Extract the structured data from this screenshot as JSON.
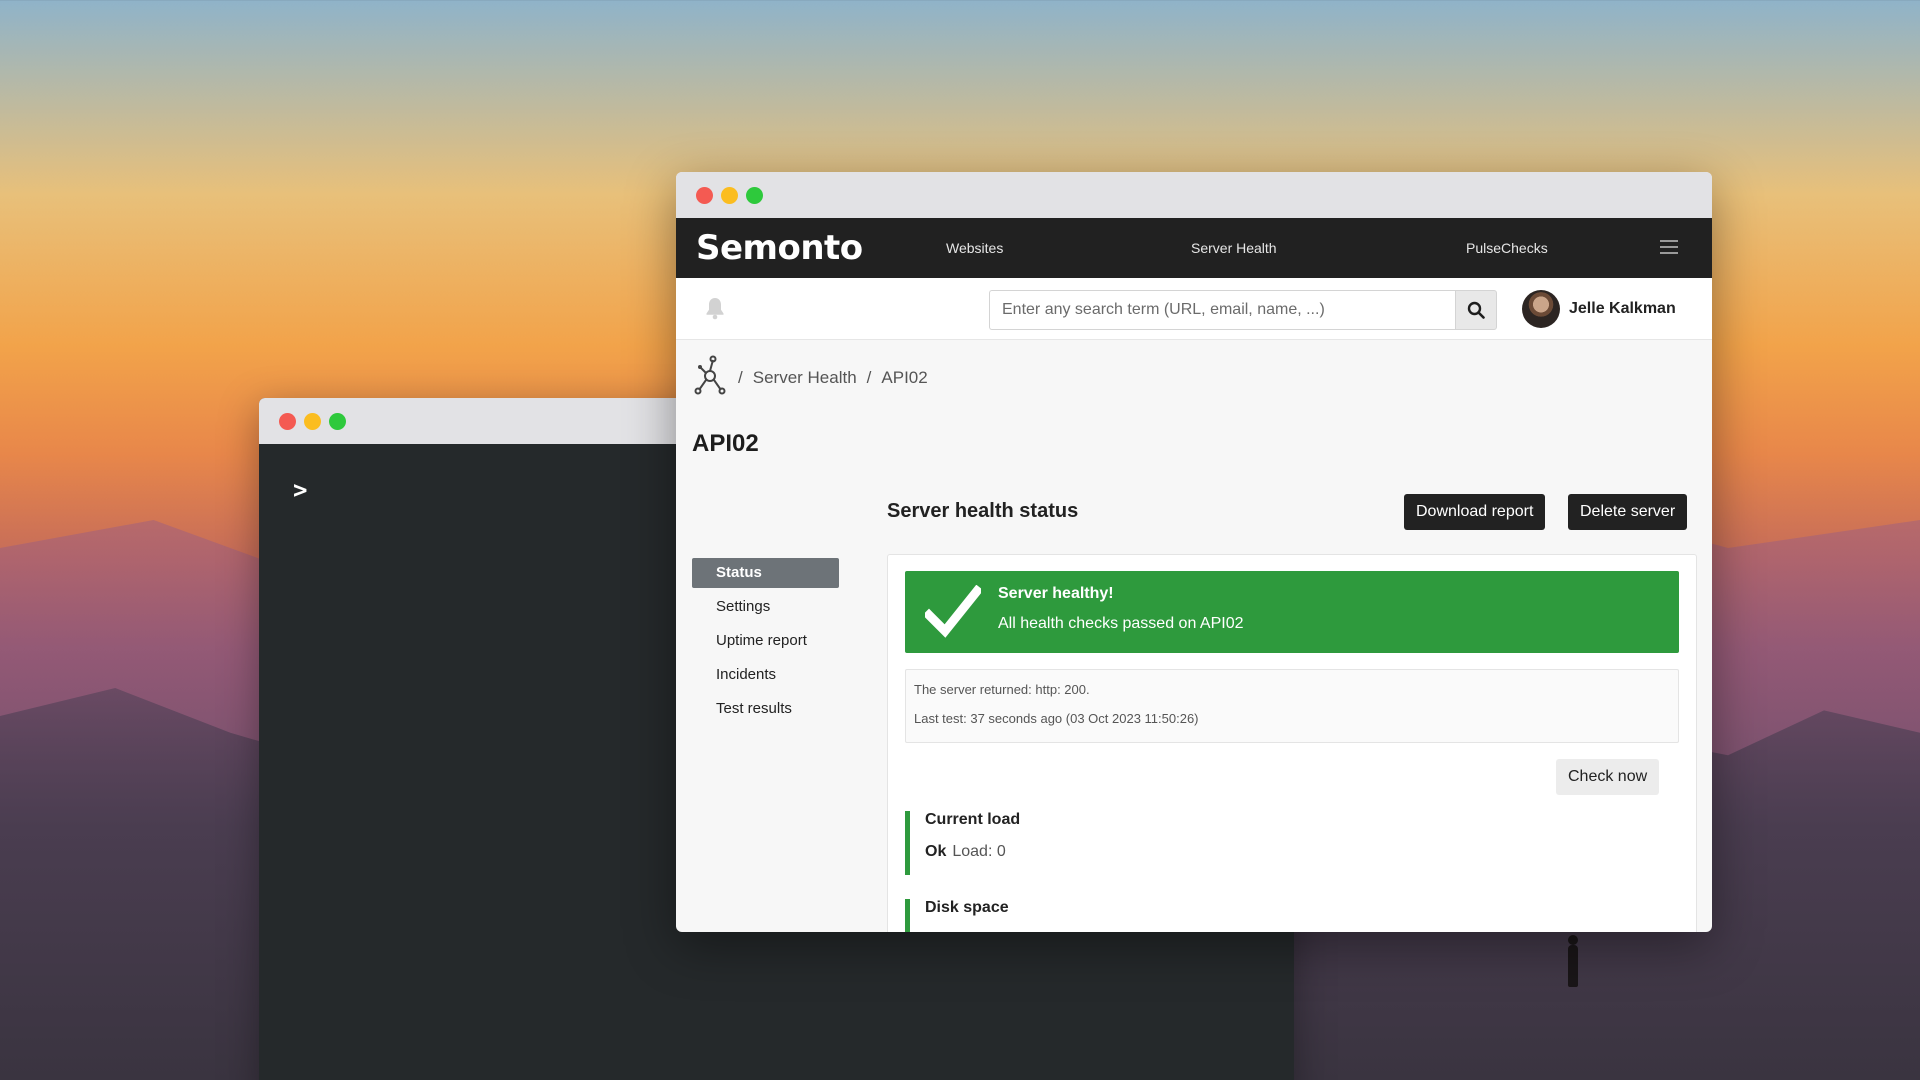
{
  "terminal": {
    "prompt": ">"
  },
  "nav": {
    "brand": "Semonto",
    "links": [
      "Websites",
      "Server Health",
      "PulseChecks"
    ]
  },
  "search": {
    "placeholder": "Enter any search term (URL, email, name, ...)"
  },
  "user": {
    "name": "Jelle Kalkman"
  },
  "breadcrumb": {
    "sep": "/",
    "items": [
      "Server Health",
      "API02"
    ]
  },
  "page": {
    "title": "API02"
  },
  "section": {
    "title": "Server health status",
    "download_label": "Download report",
    "delete_label": "Delete server"
  },
  "sidebar": {
    "items": [
      {
        "label": "Status",
        "active": true
      },
      {
        "label": "Settings"
      },
      {
        "label": "Uptime report"
      },
      {
        "label": "Incidents"
      },
      {
        "label": "Test results"
      }
    ]
  },
  "status": {
    "title": "Server healthy!",
    "message": "All health checks passed on API02",
    "color": "#2e9a3d"
  },
  "info": {
    "returned": "The server returned: http: 200.",
    "last_test": "Last test: 37 seconds ago (03 Oct 2023 11:50:26)"
  },
  "actions": {
    "check_now": "Check now"
  },
  "metrics": [
    {
      "title": "Current load",
      "state": "Ok",
      "detail": "Load: 0"
    },
    {
      "title": "Disk space"
    }
  ]
}
